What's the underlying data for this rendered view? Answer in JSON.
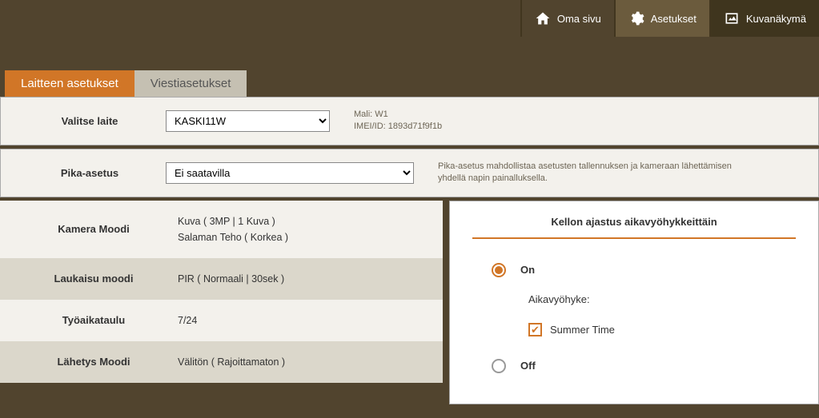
{
  "nav": {
    "home": "Oma sivu",
    "settings": "Asetukset",
    "gallery": "Kuvanäkymä"
  },
  "tabs": {
    "device": "Laitteen asetukset",
    "message": "Viestiasetukset"
  },
  "device_row": {
    "label": "Valitse laite",
    "selected": "KASKI11W",
    "model_label": "Mali:",
    "model_value": "W1",
    "imei_label": "IMEI/ID:",
    "imei_value": "1893d71f9f1b"
  },
  "quick_row": {
    "label": "Pika-asetus",
    "selected": "Ei saatavilla",
    "help": "Pika-asetus mahdollistaa asetusten tallennuksen ja kameraan lähettämisen yhdellä napin painalluksella."
  },
  "settings": {
    "camera_mode": {
      "label": "Kamera Moodi",
      "line1": "Kuva  (  3MP  |  1 Kuva  )",
      "line2": "Salaman Teho  (  Korkea  )"
    },
    "trigger": {
      "label": "Laukaisu moodi",
      "value": "PIR  (  Normaali  |  30sek  )"
    },
    "schedule": {
      "label": "Työaikataulu",
      "value": "7/24"
    },
    "send": {
      "label": "Lähetys Moodi",
      "value": "Välitön  (  Rajoittamaton  )"
    }
  },
  "clock": {
    "title": "Kellon ajastus aikavyöhykkeittäin",
    "on": "On",
    "tz_label": "Aikavyöhyke:",
    "summertime": "Summer Time",
    "off": "Off"
  }
}
